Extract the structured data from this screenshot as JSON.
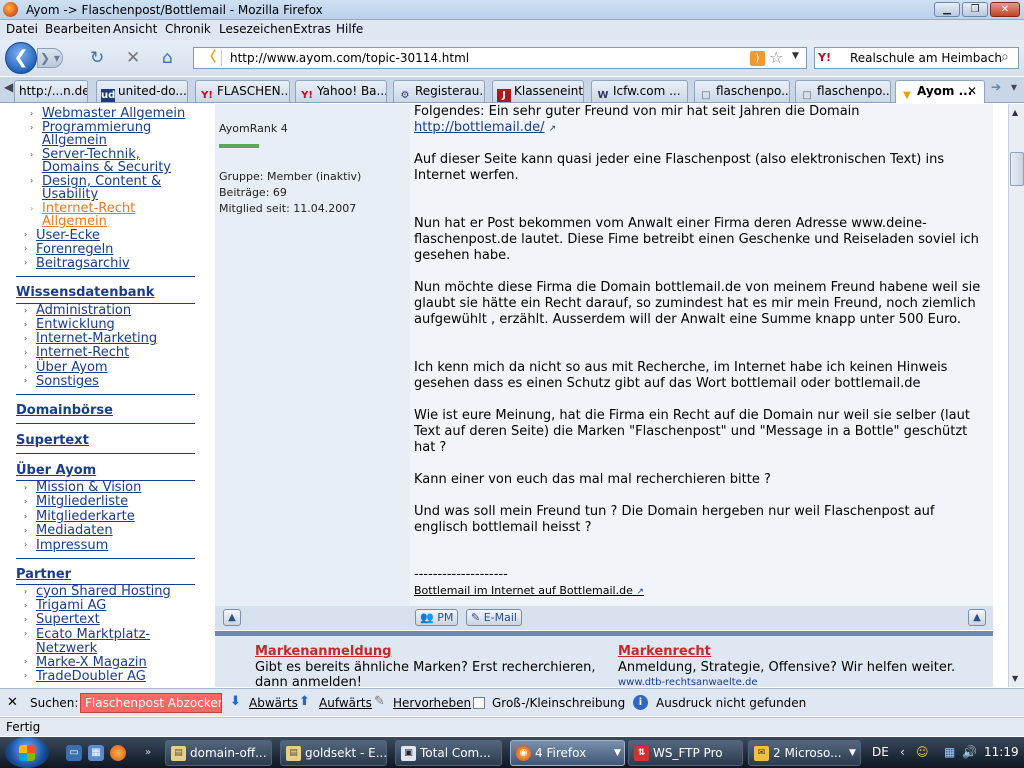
{
  "window": {
    "title": "Ayom -> Flaschenpost/Bottlemail - Mozilla Firefox",
    "minimize": "▁",
    "maximize": "❐",
    "close": "✕"
  },
  "menu": [
    "Datei",
    "Bearbeiten",
    "Ansicht",
    "Chronik",
    "Lesezeichen",
    "Extras",
    "Hilfe"
  ],
  "nav": {
    "url": "http://www.ayom.com/topic-30114.html",
    "search_value": "Realschule am Heimbach",
    "search_engine_icon": "Y!"
  },
  "tabs": [
    {
      "label": "http:/...n.de/",
      "icon": ""
    },
    {
      "label": "united-do...",
      "icon": "ud"
    },
    {
      "label": "FLASCHEN...",
      "icon": "Y!"
    },
    {
      "label": "Yahoo! Ba...",
      "icon": "Y!"
    },
    {
      "label": "Registerau...",
      "icon": "⚙"
    },
    {
      "label": "Klasseneint...",
      "icon": "J"
    },
    {
      "label": "Icfw.com ...",
      "icon": "W"
    },
    {
      "label": "flaschenpo...",
      "icon": "□"
    },
    {
      "label": "flaschenpo...",
      "icon": "□"
    },
    {
      "label": "Ayom ...",
      "icon": "▼"
    }
  ],
  "sidebar": {
    "top_subitems": [
      "Webmaster Allgemein",
      "Programmierung Allgemein",
      "Server-Technik, Domains & Security",
      "Design, Content & Usability",
      "Internet-Recht Allgemein"
    ],
    "top_items": [
      "User-Ecke",
      "Forenregeln",
      "Beitragsarchiv"
    ],
    "wissen_head": "Wissensdatenbank",
    "wissen_items": [
      "Administration",
      "Entwicklung",
      "Internet-Marketing",
      "Internet-Recht",
      "Über Ayom",
      "Sonstiges"
    ],
    "domainboerse": "Domainbörse",
    "supertext": "Supertext",
    "ueber_head": "Über Ayom",
    "ueber_items": [
      "Mission & Vision",
      "Mitgliederliste",
      "Mitgliederkarte",
      "Mediadaten",
      "Impressum"
    ],
    "partner_head": "Partner",
    "partner_items": [
      "cyon Shared Hosting",
      "Trigami AG",
      "Supertext",
      "Ecato Marktplatz-Netzwerk",
      "Marke-X Magazin",
      "TradeDoubler AG"
    ]
  },
  "post": {
    "rank": "AyomRank 4",
    "gruppe": "Gruppe: Member (inaktiv)",
    "beitraege": "Beiträge: 69",
    "mitglied": "Mitglied seit: 11.04.2007",
    "p1": "Folgendes: Ein sehr guter Freund von mir hat seit Jahren die Domain",
    "p1_link": "http://bottlemail.de/",
    "p2": "Auf dieser Seite kann quasi jeder eine Flaschenpost (also elektronischen Text) ins Internet werfen.",
    "p3": "Nun hat er Post bekommen vom Anwalt einer Firma deren Adresse www.deine-flaschenpost.de lautet. Diese Fime betreibt einen Geschenke und Reiseladen soviel ich gesehen habe.",
    "p4": "Nun möchte diese Firma die Domain bottlemail.de von meinem Freund habene weil sie glaubt sie hätte ein Recht darauf, so zumindest hat es mir mein Freund, noch ziemlich aufgewühlt , erzählt. Ausserdem will der Anwalt eine Summe knapp unter 500 Euro.",
    "p5": "Ich kenn mich da nicht so aus mit Recherche, im Internet habe ich keinen Hinweis gesehen dass es einen Schutz gibt auf das Wort bottlemail oder bottlemail.de",
    "p6": "Wie ist eure Meinung, hat die Firma ein Recht auf die Domain nur weil sie selber (laut Text auf deren Seite) die Marken \"Flaschenpost\" und \"Message in a Bottle\" geschützt hat ?",
    "p7": "Kann einer von euch das mal mal recherchieren bitte ?",
    "p8": "Und was soll mein Freund tun ? Die Domain hergeben nur weil Flaschenpost auf englisch bottlemail heisst ?",
    "sig_sep": "--------------------",
    "sig_link": "Bottlemail im Internet auf Bottlemail.de",
    "pm_label": "PM",
    "email_label": "E-Mail"
  },
  "ads": {
    "a1_title": "Markenanmeldung",
    "a1_text": "Gibt es bereits ähnliche Marken? Erst recherchieren, dann anmelden!",
    "a2_title": "Markenrecht",
    "a2_text": "Anmeldung, Strategie, Offensive? Wir helfen weiter.",
    "a2_url": "www.dtb-rechtsanwaelte.de"
  },
  "findbar": {
    "label": "Suchen:",
    "value": "Flaschenpost Abzocker?",
    "down": "Abwärts",
    "up": "Aufwärts",
    "highlight": "Hervorheben",
    "case": "Groß-/Kleinschreibung",
    "status": "Ausdruck nicht gefunden"
  },
  "status": "Fertig",
  "taskbar": {
    "tasks": [
      {
        "label": "domain-off...",
        "icon": "▤"
      },
      {
        "label": "goldsekt - E...",
        "icon": "▤"
      },
      {
        "label": "Total Com...",
        "icon": "▣"
      },
      {
        "label": "4 Firefox",
        "icon": "◉"
      },
      {
        "label": "WS_FTP Pro",
        "icon": "⇅"
      },
      {
        "label": "2 Microso...",
        "icon": "✉"
      }
    ],
    "lang": "DE",
    "time": "11:19"
  },
  "colors": {
    "link": "#1a3c8c",
    "highlight_link": "#f07818",
    "ad_title": "#c8262c",
    "find_error": "#ff6666"
  }
}
